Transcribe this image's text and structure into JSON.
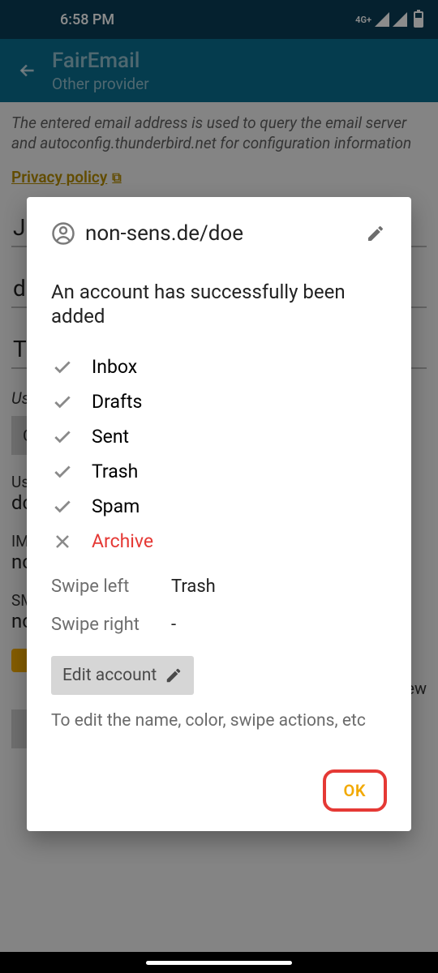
{
  "status": {
    "time": "6:58 PM",
    "network_label": "4G+"
  },
  "appbar": {
    "title": "FairEmail",
    "subtitle": "Other provider"
  },
  "page": {
    "intro": "The entered email address is used to query the email server and autoconfig.thunderbird.net for configuration information",
    "privacy_label": "Privacy policy",
    "name_field": "J",
    "address_field": "d",
    "password_field": "T",
    "use_label": "Us",
    "button_check": "C",
    "use2_label": "Us",
    "use2_value": "dc",
    "imap_label": "IM",
    "imap_value": "nc",
    "smtp_label": "SM",
    "smtp_value": "nc",
    "ew": "ew"
  },
  "dialog": {
    "account": "non-sens.de/doe",
    "message": "An account has successfully been added",
    "folders": [
      {
        "name": "Inbox",
        "ok": true
      },
      {
        "name": "Drafts",
        "ok": true
      },
      {
        "name": "Sent",
        "ok": true
      },
      {
        "name": "Trash",
        "ok": true
      },
      {
        "name": "Spam",
        "ok": true
      },
      {
        "name": "Archive",
        "ok": false
      }
    ],
    "swipe_left_label": "Swipe left",
    "swipe_left_value": "Trash",
    "swipe_right_label": "Swipe right",
    "swipe_right_value": "-",
    "edit_label": "Edit account",
    "edit_note": "To edit the name, color, swipe actions, etc",
    "ok_label": "OK"
  }
}
